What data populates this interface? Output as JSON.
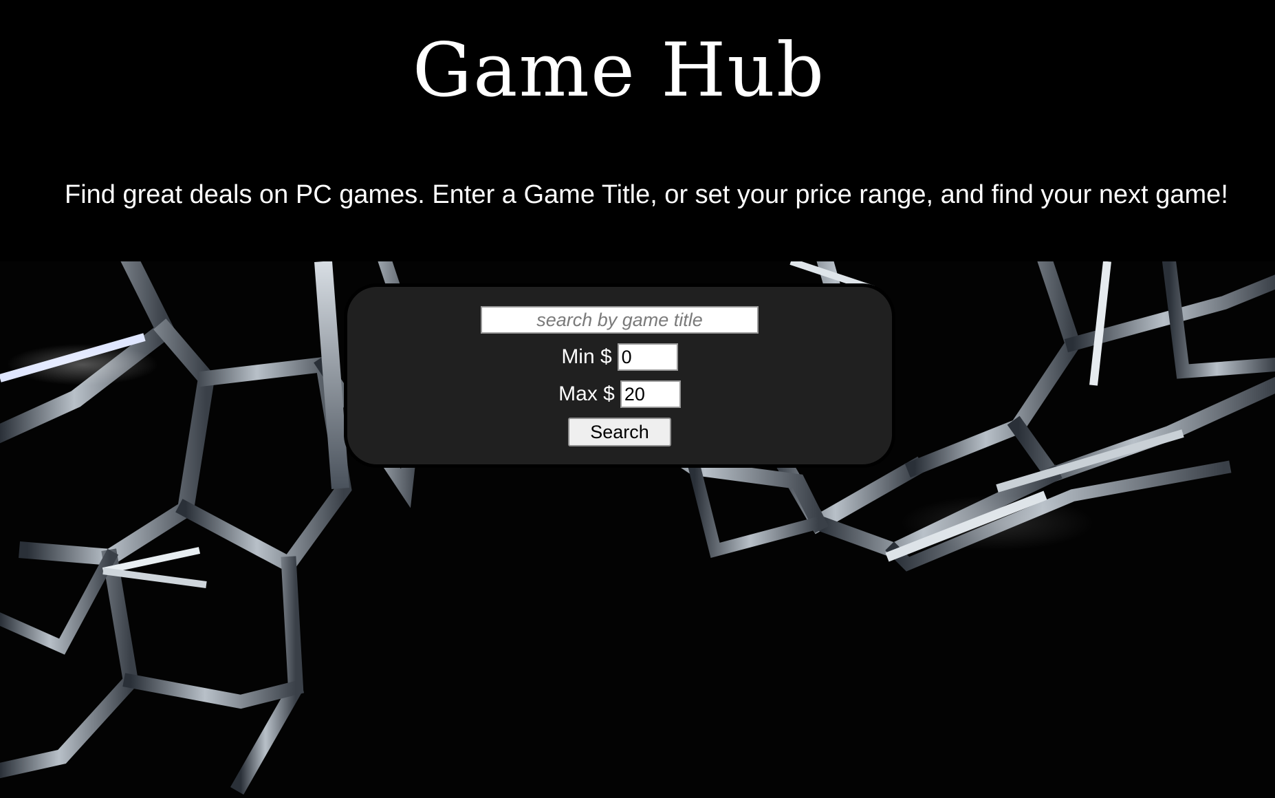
{
  "header": {
    "title": "Game Hub",
    "tagline": "Find great deals on PC games. Enter a Game Title, or set your price range, and find your next game!"
  },
  "search": {
    "title_placeholder": "search by game title",
    "title_value": "",
    "min_label": "Min $",
    "min_value": "0",
    "max_label": "Max $",
    "max_value": "20",
    "button_label": "Search"
  },
  "colors": {
    "background": "#000000",
    "panel": "#202020",
    "text": "#ffffff"
  }
}
